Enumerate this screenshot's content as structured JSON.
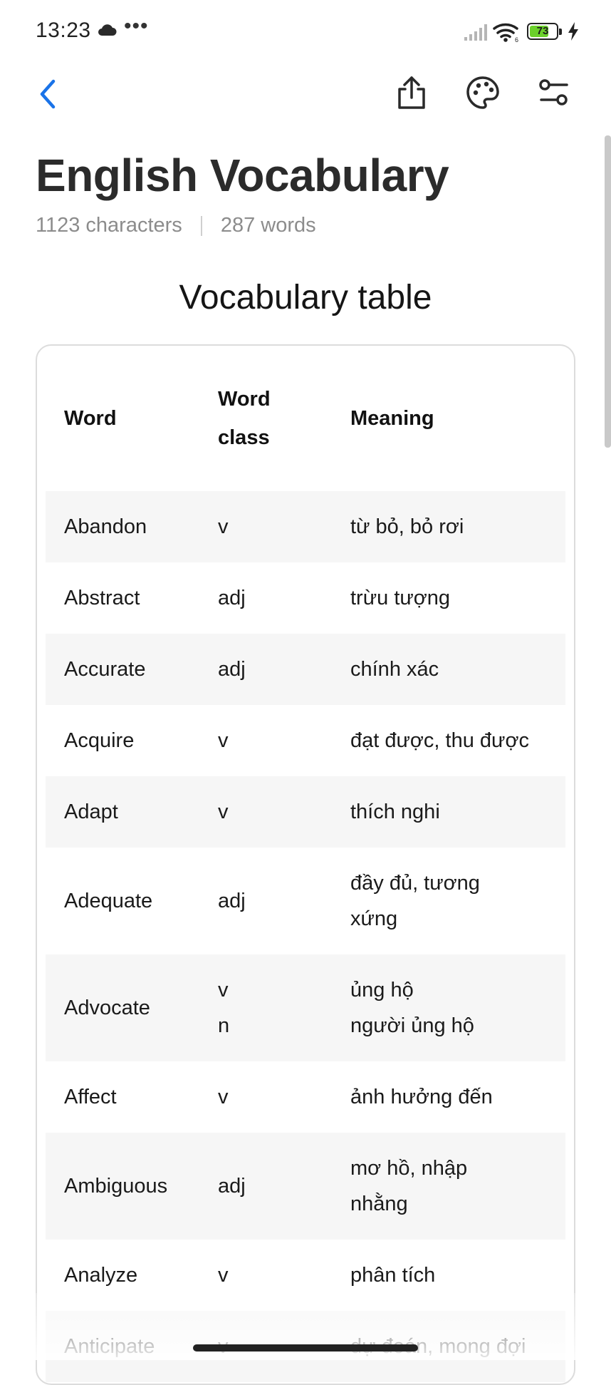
{
  "status_bar": {
    "time": "13:23",
    "more_indicator": "•••",
    "battery_level": "73",
    "battery_fraction": 0.73,
    "icons": [
      "cloud-icon",
      "more-dots-icon",
      "signal-icon",
      "wifi-icon",
      "battery-icon",
      "charging-icon"
    ]
  },
  "toolbar": {
    "icons": [
      "back-arrow-icon",
      "share-icon",
      "palette-icon",
      "settings-sliders-icon"
    ],
    "accent_color": "#1a73e8"
  },
  "document": {
    "title": "English Vocabulary",
    "characters": "1123 characters",
    "words": "287 words",
    "section_heading": "Vocabulary table"
  },
  "table": {
    "headers": {
      "word": "Word",
      "word_class_line1": "Word",
      "word_class_line2": "class",
      "meaning": "Meaning"
    },
    "rows": [
      {
        "word": "Abandon",
        "word_class": [
          "v"
        ],
        "meaning": [
          "từ bỏ, bỏ rơi"
        ]
      },
      {
        "word": "Abstract",
        "word_class": [
          "adj"
        ],
        "meaning": [
          "trừu tượng"
        ]
      },
      {
        "word": "Accurate",
        "word_class": [
          "adj"
        ],
        "meaning": [
          "chính xác"
        ]
      },
      {
        "word": "Acquire",
        "word_class": [
          "v"
        ],
        "meaning": [
          "đạt được, thu được"
        ]
      },
      {
        "word": "Adapt",
        "word_class": [
          "v"
        ],
        "meaning": [
          "thích nghi"
        ]
      },
      {
        "word": "Adequate",
        "word_class": [
          "adj"
        ],
        "meaning": [
          "đầy đủ, tương",
          "xứng"
        ]
      },
      {
        "word": "Advocate",
        "word_class": [
          "v",
          "n"
        ],
        "meaning": [
          "ủng hộ",
          "người ủng hộ"
        ]
      },
      {
        "word": "Affect",
        "word_class": [
          "v"
        ],
        "meaning": [
          "ảnh hưởng đến"
        ]
      },
      {
        "word": "Ambiguous",
        "word_class": [
          "adj"
        ],
        "meaning": [
          "mơ hồ, nhập",
          "nhằng"
        ]
      },
      {
        "word": "Analyze",
        "word_class": [
          "v"
        ],
        "meaning": [
          "phân tích"
        ]
      },
      {
        "word": "Anticipate",
        "word_class": [
          "v"
        ],
        "meaning": [
          "dự đoán, mong đợi"
        ]
      }
    ]
  }
}
